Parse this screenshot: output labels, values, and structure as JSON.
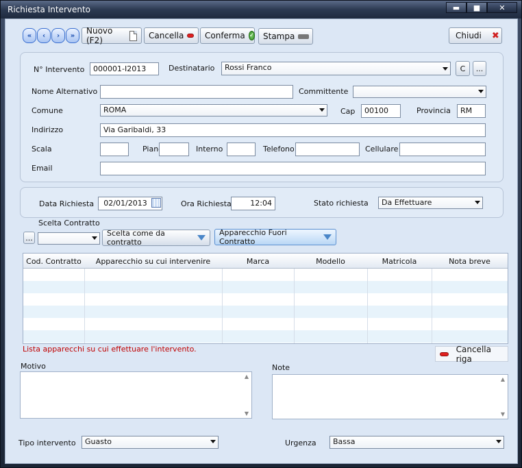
{
  "window": {
    "title": "Richiesta Intervento",
    "minimize": "▬",
    "maximize": "■",
    "close": "✕"
  },
  "toolbar": {
    "nav": [
      "«",
      "‹",
      "›",
      "»"
    ],
    "new_label": "Nuovo (F2)",
    "delete_label": "Cancella",
    "confirm_label": "Conferma",
    "print_label": "Stampa",
    "close_label": "Chiudi"
  },
  "form": {
    "n_intervento_label": "N° Intervento",
    "n_intervento_value": "000001-I2013",
    "destinatario_label": "Destinatario",
    "destinatario_value": "Rossi Franco",
    "c_button": "C",
    "more_button": "...",
    "nome_alt_label": "Nome Alternativo",
    "nome_alt_value": "",
    "committente_label": "Committente",
    "committente_value": "",
    "comune_label": "Comune",
    "comune_value": "ROMA",
    "cap_label": "Cap",
    "cap_value": "00100",
    "provincia_label": "Provincia",
    "provincia_value": "RM",
    "indirizzo_label": "Indirizzo",
    "indirizzo_value": "Via Garibaldi, 33",
    "scala_label": "Scala",
    "piano_label": "Piano",
    "interno_label": "Interno",
    "telefono_label": "Telefono",
    "cellulare_label": "Cellulare",
    "email_label": "Email"
  },
  "richiesta": {
    "data_label": "Data Richiesta",
    "data_value": "02/01/2013",
    "ora_label": "Ora Richiesta",
    "ora_value": "12:04",
    "stato_label": "Stato richiesta",
    "stato_value": "Da Effettuare"
  },
  "contratto": {
    "label": "Scelta Contratto",
    "more_button": "...",
    "value": "",
    "scelta_button": "Scelta come da contratto",
    "fuori_button": "Apparecchio Fuori Contratto"
  },
  "grid": {
    "columns": [
      "Cod. Contratto",
      "Apparecchio su cui intervenire",
      "Marca",
      "Modello",
      "Matricola",
      "Nota breve"
    ],
    "rows": []
  },
  "grid_hint": "Lista apparecchi su cui effettuare l'intervento.",
  "cancella_riga": "Cancella riga",
  "motivo_label": "Motivo",
  "note_label": "Note",
  "tipo_label": "Tipo intervento",
  "tipo_value": "Guasto",
  "urgenza_label": "Urgenza",
  "urgenza_value": "Bassa",
  "colors": {
    "accent": "#3a6fd0",
    "error_text": "#c00000",
    "client_bg": "#dce7f5"
  }
}
